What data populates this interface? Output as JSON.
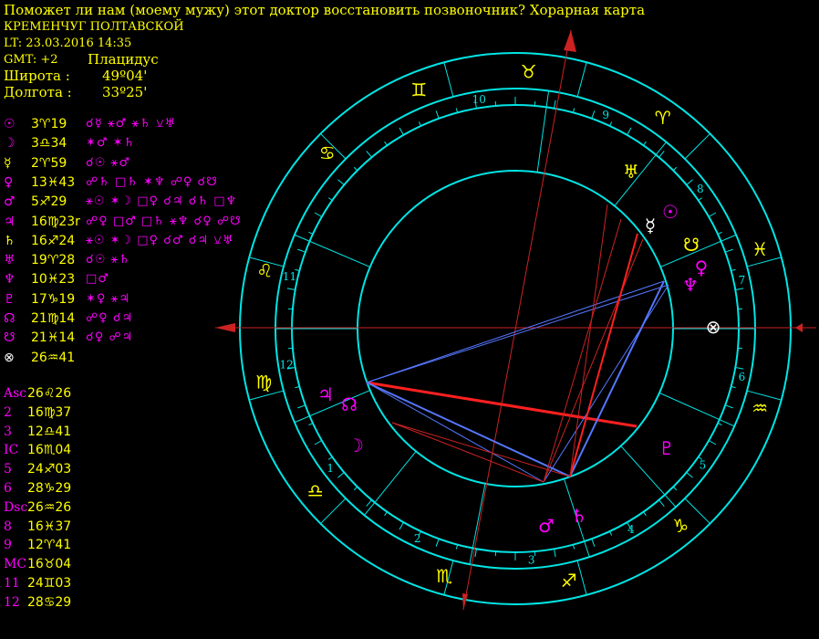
{
  "header": {
    "title": "Поможет ли нам (моему мужу) этот доктор восстановить позвоночник? Хорарная карта",
    "place": "КРЕМЕНЧУГ ПОЛТАВСКОЙ",
    "lt": "LT: 23.03.2016  14:35",
    "gmt": "GMT: +2",
    "system": "Плацидус",
    "lat_label": "Широта :",
    "lat_value": "49º04'",
    "lon_label": "Долгота :",
    "lon_value": "33º25'"
  },
  "planets": [
    {
      "glyph": "☉",
      "pos": "3♈19",
      "aspects": "☌☿ ⚹♂ ⚹♄ ⚺♅",
      "color": "#ff00ff"
    },
    {
      "glyph": "☽",
      "pos": "3♎34",
      "aspects": "✶♂ ✶♄",
      "color": "#ff00ff"
    },
    {
      "glyph": "☿",
      "pos": "2♈59",
      "aspects": "☌☉ ⚹♂",
      "color": "#ffff00"
    },
    {
      "glyph": "♀",
      "pos": "13♓43",
      "aspects": "☍♄ □♄ ✶♆ ☍♀ ☌☋",
      "color": "#ff00ff"
    },
    {
      "glyph": "♂",
      "pos": "5♐29",
      "aspects": "⚹☉ ✶☽ □♀ ☌♃ ☌♄ □♆",
      "color": "#ff00ff"
    },
    {
      "glyph": "♃",
      "pos": "16♍23r",
      "aspects": "☍♀ □♂ □♄ ⚹♆ ☌♀ ☍☋",
      "color": "#ff00ff"
    },
    {
      "glyph": "♄",
      "pos": "16♐24",
      "aspects": "⚹☉ ✶☽ □♀ ☌♂ ☌♃ ⚺♅",
      "color": "#ffff00"
    },
    {
      "glyph": "♅",
      "pos": "19♈28",
      "aspects": "☌☉ ⚹♄",
      "color": "#ff00ff"
    },
    {
      "glyph": "♆",
      "pos": "10♓23",
      "aspects": "□♂",
      "color": "#ff00ff"
    },
    {
      "glyph": "♇",
      "pos": "17♑19",
      "aspects": "✶♀ ⚹♃",
      "color": "#ff00ff"
    },
    {
      "glyph": "☊",
      "pos": "21♍14",
      "aspects": "☍♀ ☌♃",
      "color": "#ff00ff"
    },
    {
      "glyph": "☋",
      "pos": "21♓14",
      "aspects": "☌♀ ☍♃",
      "color": "#ff00ff"
    },
    {
      "glyph": "⊗",
      "pos": "26♒41",
      "aspects": "",
      "color": "#ffffff"
    }
  ],
  "houses": [
    {
      "n": "Asc",
      "v": "26♌26"
    },
    {
      "n": "2",
      "v": "16♍37"
    },
    {
      "n": "3",
      "v": "12♎41"
    },
    {
      "n": "IC",
      "v": "16♏04"
    },
    {
      "n": "5",
      "v": "24♐03"
    },
    {
      "n": "6",
      "v": "28♑29"
    },
    {
      "n": "Dsc",
      "v": "26♒26"
    },
    {
      "n": "8",
      "v": "16♓37"
    },
    {
      "n": "9",
      "v": "12♈41"
    },
    {
      "n": "MC",
      "v": "16♉04"
    },
    {
      "n": "11",
      "v": "24♊03"
    },
    {
      "n": "12",
      "v": "28♋29"
    }
  ],
  "wheel": {
    "signs": [
      {
        "glyph": "♊",
        "color": "#ffff00"
      },
      {
        "glyph": "♉",
        "color": "#ffff00"
      },
      {
        "glyph": "♈",
        "color": "#ffff00"
      },
      {
        "glyph": "♓",
        "color": "#ffff00"
      },
      {
        "glyph": "♒",
        "color": "#ffff00"
      },
      {
        "glyph": "♑",
        "color": "#ffff00"
      },
      {
        "glyph": "♐",
        "color": "#ffff00"
      },
      {
        "glyph": "♏",
        "color": "#ffff00"
      },
      {
        "glyph": "♎",
        "color": "#ffff00"
      },
      {
        "glyph": "♍",
        "color": "#ffff00"
      },
      {
        "glyph": "♌",
        "color": "#ffff00"
      },
      {
        "glyph": "♋",
        "color": "#ffff00"
      }
    ],
    "house_numbers": [
      "10",
      "9",
      "8",
      "7",
      "6",
      "5",
      "4",
      "3",
      "2",
      "1",
      "12",
      "11"
    ],
    "planet_marks": [
      {
        "glyph": "♅",
        "color": "#ffff00"
      },
      {
        "glyph": "☉",
        "color": "#ff00ff"
      },
      {
        "glyph": "☿",
        "color": "#ffffff"
      },
      {
        "glyph": "☋",
        "color": "#ffff00"
      },
      {
        "glyph": "♀",
        "color": "#ff00ff"
      },
      {
        "glyph": "♆",
        "color": "#ff00ff"
      },
      {
        "glyph": "⊗",
        "color": "#ffffff"
      },
      {
        "glyph": "♇",
        "color": "#ff00ff"
      },
      {
        "glyph": "♄",
        "color": "#ff00ff"
      },
      {
        "glyph": "♂",
        "color": "#ff00ff"
      },
      {
        "glyph": "☽",
        "color": "#ff00ff"
      },
      {
        "glyph": "♃",
        "color": "#ff00ff"
      },
      {
        "glyph": "☊",
        "color": "#ff00ff"
      }
    ]
  }
}
